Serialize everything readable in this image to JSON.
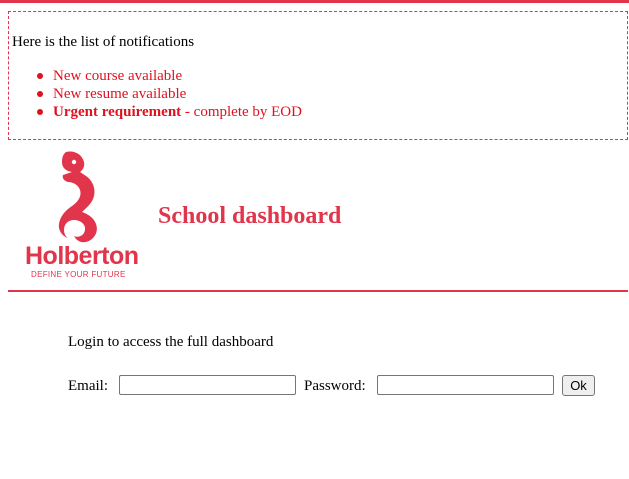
{
  "notifications": {
    "intro": "Here is the list of notifications",
    "items": [
      {
        "text": "New course available"
      },
      {
        "text": "New resume available"
      },
      {
        "bold": "Urgent requirement",
        "rest": " - complete by EOD"
      }
    ],
    "color": "#e0111f"
  },
  "header": {
    "logo_name": "Holberton",
    "logo_tagline": "DEFINE YOUR FUTURE",
    "title": "School dashboard",
    "accent_color": "#e0354b"
  },
  "body": {
    "login_text": "Login to access the full dashboard",
    "email_label": "Email:",
    "email_value": "",
    "password_label": "Password:",
    "password_value": "",
    "ok_label": "Ok"
  }
}
